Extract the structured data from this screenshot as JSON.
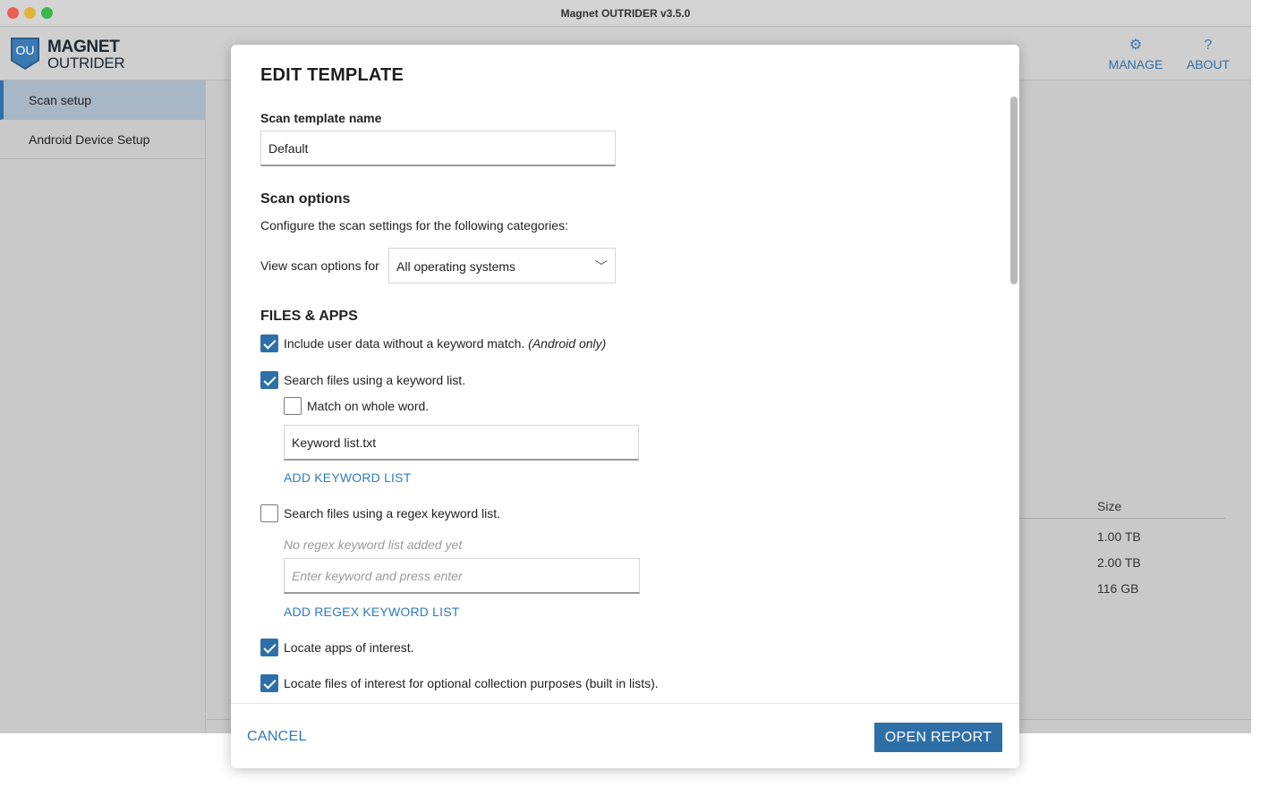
{
  "window": {
    "title": "Magnet OUTRIDER v3.5.0"
  },
  "header": {
    "logo_mark": "OU",
    "logo_line1": "MAGNET",
    "logo_line2": "OUTRIDER",
    "manage_icon": "gear-icon",
    "manage_label": "MANAGE",
    "about_icon": "question-icon",
    "about_label": "ABOUT"
  },
  "sidebar": {
    "items": [
      {
        "label": "Scan setup",
        "active": true
      },
      {
        "label": "Android Device Setup",
        "active": false
      }
    ]
  },
  "background": {
    "size_header": "Size",
    "sizes": [
      "1.00 TB",
      "2.00 TB",
      "116 GB"
    ]
  },
  "modal": {
    "title": "EDIT TEMPLATE",
    "template_name_label": "Scan template name",
    "template_name_value": "Default",
    "scan_options_heading": "Scan options",
    "scan_options_desc": "Configure the scan settings for the following categories:",
    "view_for_label": "View scan options for",
    "view_for_value": "All operating systems",
    "files_apps_heading": "FILES & APPS",
    "options": {
      "include_user_data": {
        "label": "Include user data without a keyword match.",
        "note": "(Android only)",
        "checked": true
      },
      "search_keyword": {
        "label": "Search files using a keyword list.",
        "checked": true
      },
      "match_whole_word": {
        "label": "Match on whole word.",
        "checked": false
      },
      "keyword_file": "Keyword list.txt",
      "add_keyword_list": "ADD KEYWORD LIST",
      "search_regex": {
        "label": "Search files using a regex keyword list.",
        "checked": false
      },
      "no_regex_hint": "No regex keyword list added yet",
      "regex_placeholder": "Enter keyword and press enter",
      "add_regex_list": "ADD REGEX KEYWORD LIST",
      "locate_apps": {
        "label": "Locate apps of interest.",
        "checked": true
      },
      "locate_files": {
        "label": "Locate files of interest for optional collection purposes (built in lists).",
        "checked": true
      }
    },
    "cancel_label": "CANCEL",
    "open_report_label": "OPEN REPORT"
  },
  "colors": {
    "accent": "#2f6fa7",
    "link": "#2f79b8"
  }
}
